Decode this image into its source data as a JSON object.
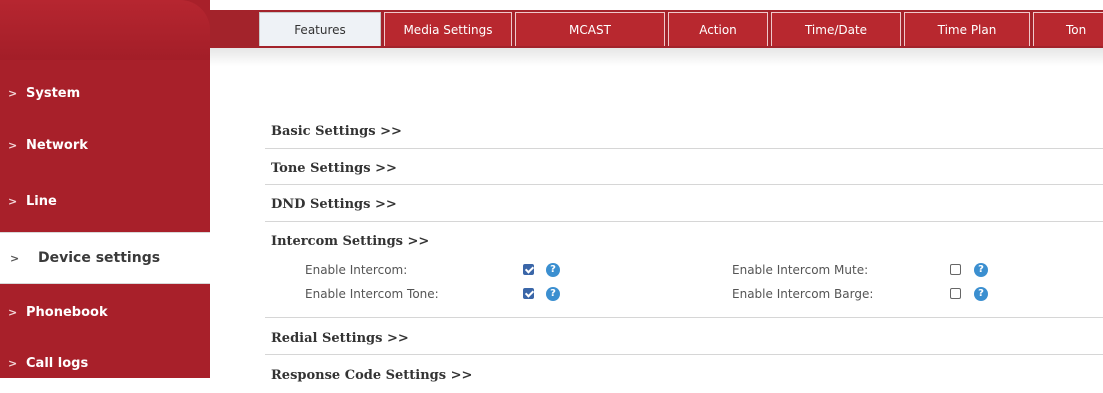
{
  "sidebar": {
    "items": [
      {
        "label": "System"
      },
      {
        "label": "Network"
      },
      {
        "label": "Line"
      },
      {
        "label": "Device settings"
      },
      {
        "label": "Phonebook"
      },
      {
        "label": "Call logs"
      }
    ],
    "chevron": ">"
  },
  "tabs": [
    {
      "label": "Features"
    },
    {
      "label": "Media Settings"
    },
    {
      "label": "MCAST"
    },
    {
      "label": "Action"
    },
    {
      "label": "Time/Date"
    },
    {
      "label": "Time Plan"
    },
    {
      "label": "Ton"
    }
  ],
  "sections": {
    "basic": "Basic Settings >>",
    "tone": "Tone Settings >>",
    "dnd": "DND Settings >>",
    "intercom": "Intercom Settings >>",
    "redial": "Redial Settings >>",
    "response": "Response Code Settings >>"
  },
  "intercom_fields": {
    "enable_intercom": {
      "label": "Enable Intercom:",
      "checked": true
    },
    "enable_intercom_tone": {
      "label": "Enable Intercom Tone:",
      "checked": true
    },
    "enable_intercom_mute": {
      "label": "Enable Intercom Mute:",
      "checked": false
    },
    "enable_intercom_barge": {
      "label": "Enable Intercom Barge:",
      "checked": false
    }
  },
  "help_glyph": "?",
  "colors": {
    "brand_red": "#a8202a",
    "help_blue": "#3b8fd0",
    "check_blue": "#3a66a8"
  }
}
